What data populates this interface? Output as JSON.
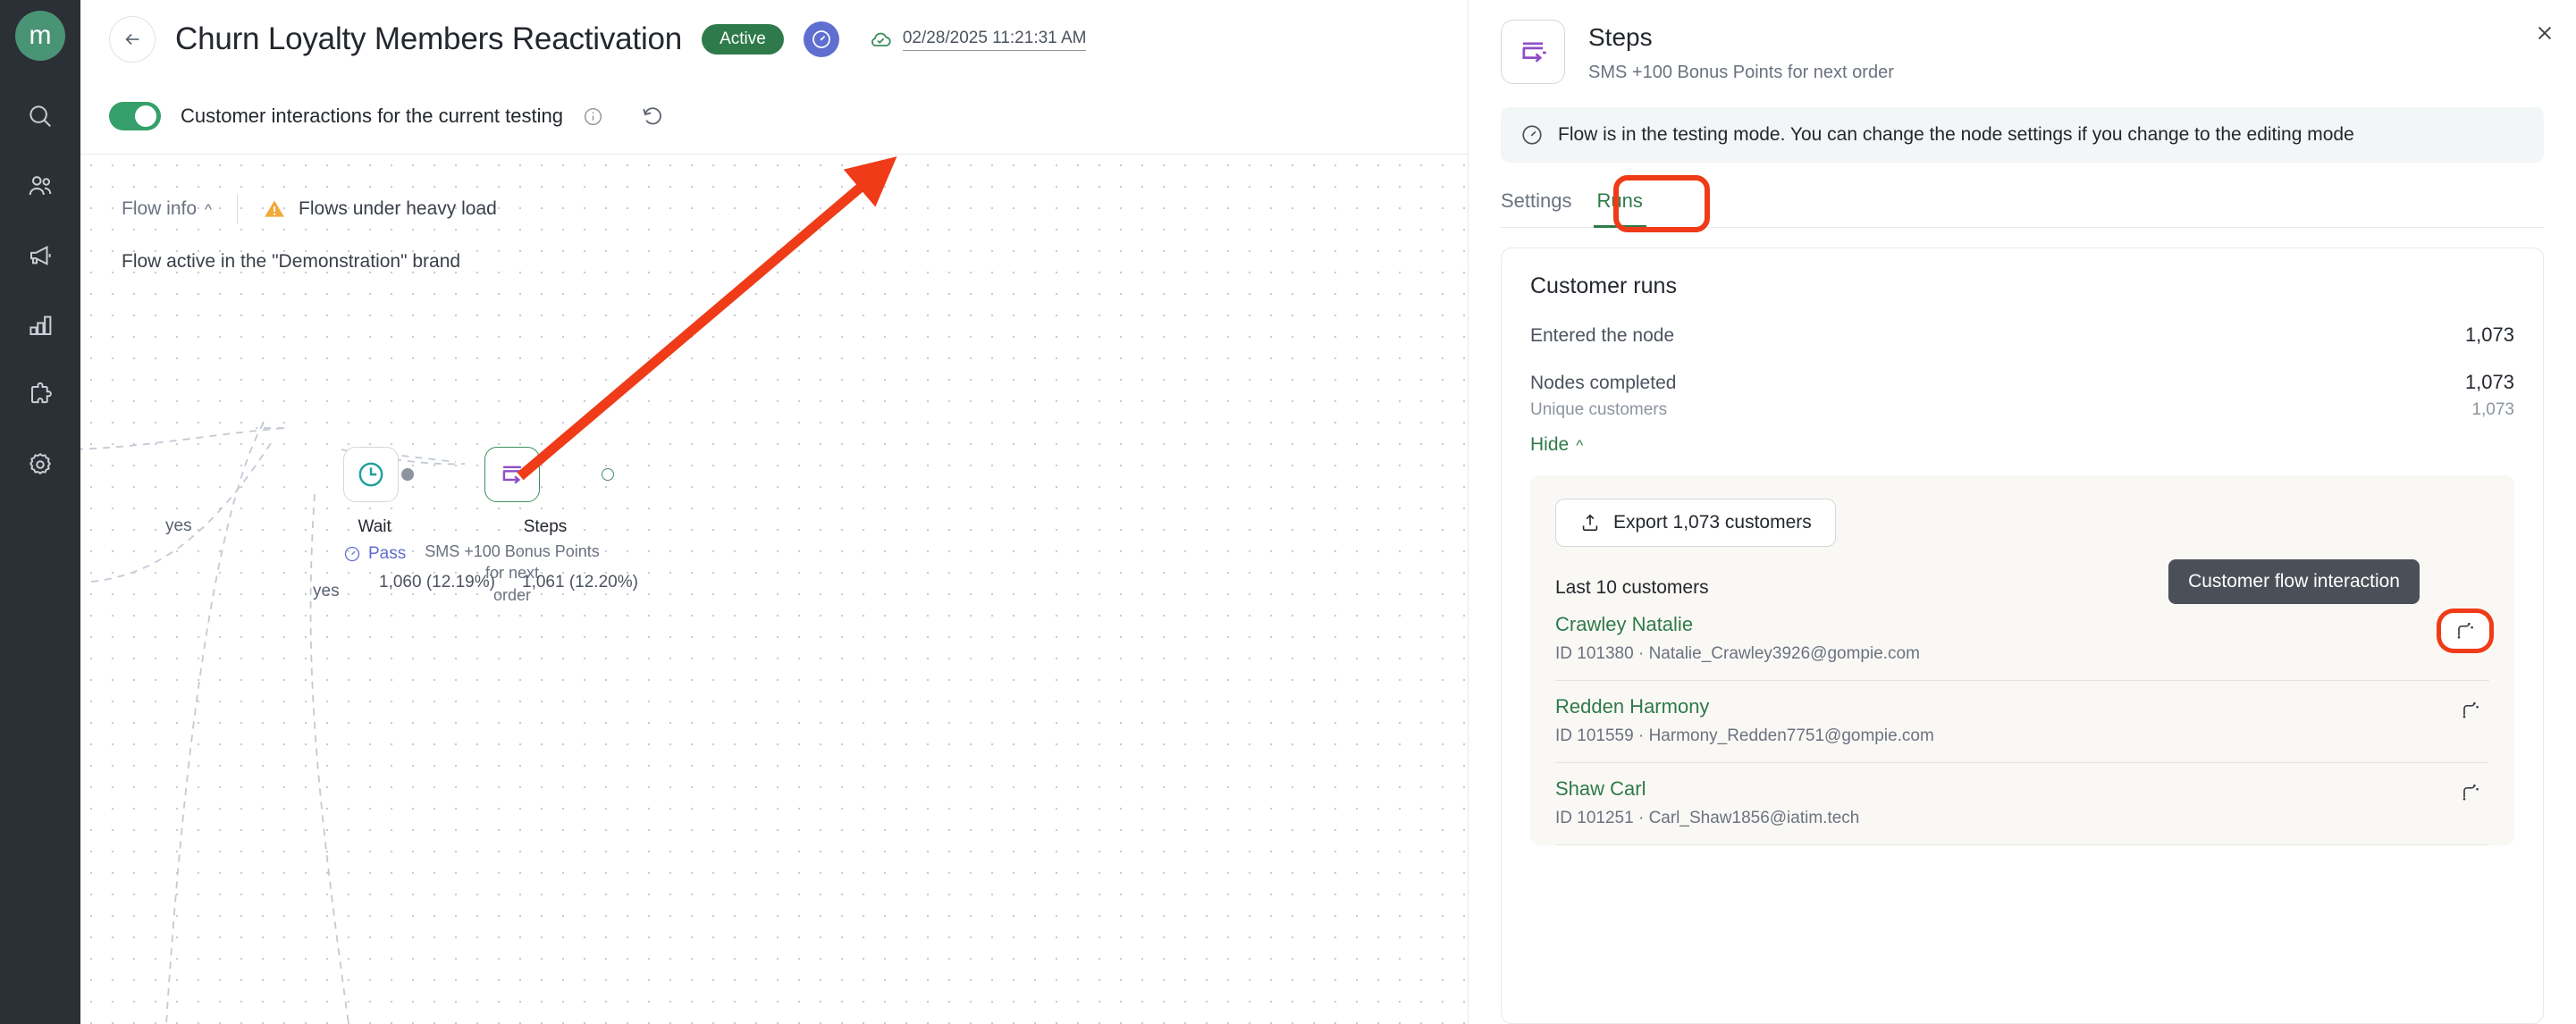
{
  "rail": {
    "logo_letter": "m",
    "items": [
      {
        "name": "search-icon",
        "label": "Search"
      },
      {
        "name": "customers-icon",
        "label": "Customers"
      },
      {
        "name": "campaigns-megaphone-icon",
        "label": "Campaigns"
      },
      {
        "name": "analytics-bar-chart-icon",
        "label": "Analytics"
      },
      {
        "name": "integrations-puzzle-icon",
        "label": "Integrations"
      },
      {
        "name": "settings-gear-icon",
        "label": "Settings"
      }
    ]
  },
  "header": {
    "back_label": "Back",
    "title": "Churn Loyalty Members Reactivation",
    "status_badge": "Active",
    "gauge_icon": "speedometer-icon",
    "cloud_icon": "cloud-check-icon",
    "timestamp": "02/28/2025 11:21:31 AM"
  },
  "subbar": {
    "toggle_on": true,
    "label": "Customer interactions for the current testing",
    "info_icon": "info-circle-icon",
    "refresh_icon": "refresh-icon"
  },
  "canvas": {
    "flow_info_label": "Flow info",
    "flow_info_chevron": "^",
    "warning_icon": "warning-triangle-icon",
    "warning_text": "Flows under heavy load",
    "brand_text": "Flow active in the \"Demonstration\" brand",
    "edge_labels": [
      {
        "text": "1,060 (12.19%)"
      },
      {
        "text": "1,061 (12.20%)"
      }
    ],
    "branch_labels": [
      "yes",
      "yes"
    ],
    "nodes": [
      {
        "id": "wait",
        "icon": "clock-icon",
        "title": "Wait",
        "status_icon": "speedometer-icon",
        "status": "Pass"
      },
      {
        "id": "steps",
        "icon": "steps-flow-icon",
        "title": "Steps",
        "subtitle_line1": "SMS +100 Bonus Points for next",
        "subtitle_line2": "order"
      }
    ]
  },
  "panel": {
    "close_icon": "close-icon",
    "node_icon": "steps-flow-icon",
    "title": "Steps",
    "subtitle": "SMS +100 Bonus Points for next order",
    "notice_icon": "speedometer-icon",
    "notice_text": "Flow is in the testing mode. You can change the node settings if you change to the editing mode",
    "tabs": [
      {
        "label": "Settings",
        "active": false
      },
      {
        "label": "Runs",
        "active": true
      }
    ],
    "runs": {
      "card_title": "Customer runs",
      "entered_label": "Entered the node",
      "entered_value": "1,073",
      "completed_label": "Nodes completed",
      "completed_value": "1,073",
      "unique_label": "Unique customers",
      "unique_value": "1,073",
      "hide_label": "Hide",
      "hide_chevron": "^",
      "export_label": "Export 1,073 customers",
      "export_icon": "upload-icon",
      "last_label": "Last 10 customers",
      "tooltip_text": "Customer flow interaction",
      "action_icon": "customer-flow-interaction-icon",
      "customers": [
        {
          "name": "Crawley Natalie",
          "meta": "ID 101380 · Natalie_Crawley3926@gompie.com"
        },
        {
          "name": "Redden Harmony",
          "meta": "ID 101559 · Harmony_Redden7751@gompie.com"
        },
        {
          "name": "Shaw Carl",
          "meta": "ID 101251 · Carl_Shaw1856@iatim.tech"
        }
      ]
    }
  },
  "colors": {
    "brand_green": "#2f7a4a",
    "toggle_green": "#35a06b",
    "accent_purple": "#8e4ec6",
    "annotation_red": "#ef3b17",
    "rail_bg": "#2b2f36",
    "pass_blue": "#5f6fd0"
  }
}
